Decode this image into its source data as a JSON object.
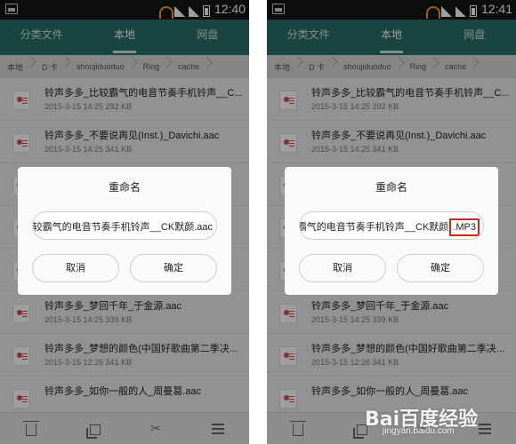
{
  "screens": [
    {
      "status": {
        "time": "12:40"
      },
      "tabs": [
        {
          "label": "分类文件",
          "active": false
        },
        {
          "label": "本地",
          "active": true
        },
        {
          "label": "网盘",
          "active": false
        }
      ],
      "breadcrumbs": [
        "本地",
        "D 卡",
        "shoujiduoduo",
        "Ring",
        "cache"
      ],
      "files": [
        {
          "name": "铃声多多_比较霸气的电音节奏手机铃声__C...",
          "meta": "2015-3-15 14:25 292 KB"
        },
        {
          "name": "铃声多多_不要说再见(Inst.)_Davichi.aac",
          "meta": "2015-3-15 14:25 341 KB"
        },
        {
          "name": "",
          "meta": ""
        },
        {
          "name": "",
          "meta": ""
        },
        {
          "name": "",
          "meta": ""
        },
        {
          "name": "铃声多多_梦回千年_于金源.aac",
          "meta": "2015-3-15 14:25 339 KB"
        },
        {
          "name": "铃声多多_梦想的颜色(中国好歌曲第二季决...",
          "meta": "2015-3-15 12:26 341 KB"
        },
        {
          "name": "铃声多多_如你一般的人_周曼葛.aac",
          "meta": ""
        }
      ],
      "dialog": {
        "title": "重命名",
        "input_value": ";较霸气的电音节奏手机铃声__CK默颜.aac",
        "highlight": "",
        "cancel_label": "取消",
        "ok_label": "确定"
      }
    },
    {
      "status": {
        "time": "12:41"
      },
      "tabs": [
        {
          "label": "分类文件",
          "active": false
        },
        {
          "label": "本地",
          "active": true
        },
        {
          "label": "网盘",
          "active": false
        }
      ],
      "breadcrumbs": [
        "本地",
        "D 卡",
        "shoujiduoduo",
        "Ring",
        "cache"
      ],
      "files": [
        {
          "name": "铃声多多_比较霸气的电音节奏手机铃声__C...",
          "meta": "2015-3-15 14:25 292 KB"
        },
        {
          "name": "铃声多多_不要说再见(Inst.)_Davichi.aac",
          "meta": "2015-3-15 14:25 341 KB"
        },
        {
          "name": "",
          "meta": ""
        },
        {
          "name": "",
          "meta": ""
        },
        {
          "name": "",
          "meta": ""
        },
        {
          "name": "铃声多多_梦回千年_于金源.aac",
          "meta": "2015-3-15 14:25 339 KB"
        },
        {
          "name": "铃声多多_梦想的颜色(中国好歌曲第二季决...",
          "meta": "2015-3-15 12:26 341 KB"
        },
        {
          "name": "铃声多多_如你一般的人_周曼葛.aac",
          "meta": ""
        }
      ],
      "dialog": {
        "title": "重命名",
        "input_value": "较霸气的电音节奏手机铃声__CK默颜",
        "highlight": ".MP3",
        "cancel_label": "取消",
        "ok_label": "确定"
      }
    }
  ],
  "watermark": {
    "logo": "Bai百度经验",
    "sub": "jingyan.baidu.com"
  },
  "icons": [
    "trash-icon",
    "copy-icon",
    "scissors-icon",
    "menu-icon",
    "music-file-icon"
  ],
  "colors": {
    "tabbar": "#2b6f67",
    "highlight": "#e21b1b"
  }
}
